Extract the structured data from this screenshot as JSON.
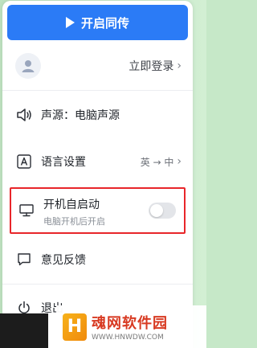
{
  "sync_button": {
    "label": "开启同传",
    "icon": "play-icon"
  },
  "account": {
    "login_label": "立即登录",
    "chevron": "›"
  },
  "menu": {
    "audio_source": {
      "label": "声源：电脑声源",
      "icon": "speaker-icon"
    },
    "language": {
      "label": "语言设置",
      "icon": "language-a-icon",
      "value": "英 → 中",
      "chevron": "›"
    },
    "autostart": {
      "title": "开机自启动",
      "subtitle": "电脑开机后开启",
      "icon": "monitor-icon",
      "enabled": false
    },
    "feedback": {
      "label": "意见反馈",
      "icon": "feedback-icon"
    },
    "exit": {
      "label": "退出",
      "icon": "power-icon"
    }
  },
  "watermark": {
    "name": "魂网软件园",
    "url": "WWW.HNWDW.COM",
    "logo_letter": "H"
  },
  "colors": {
    "accent": "#2b7bf6",
    "highlight_border": "#e8262a",
    "background": "#c6e8c8"
  }
}
